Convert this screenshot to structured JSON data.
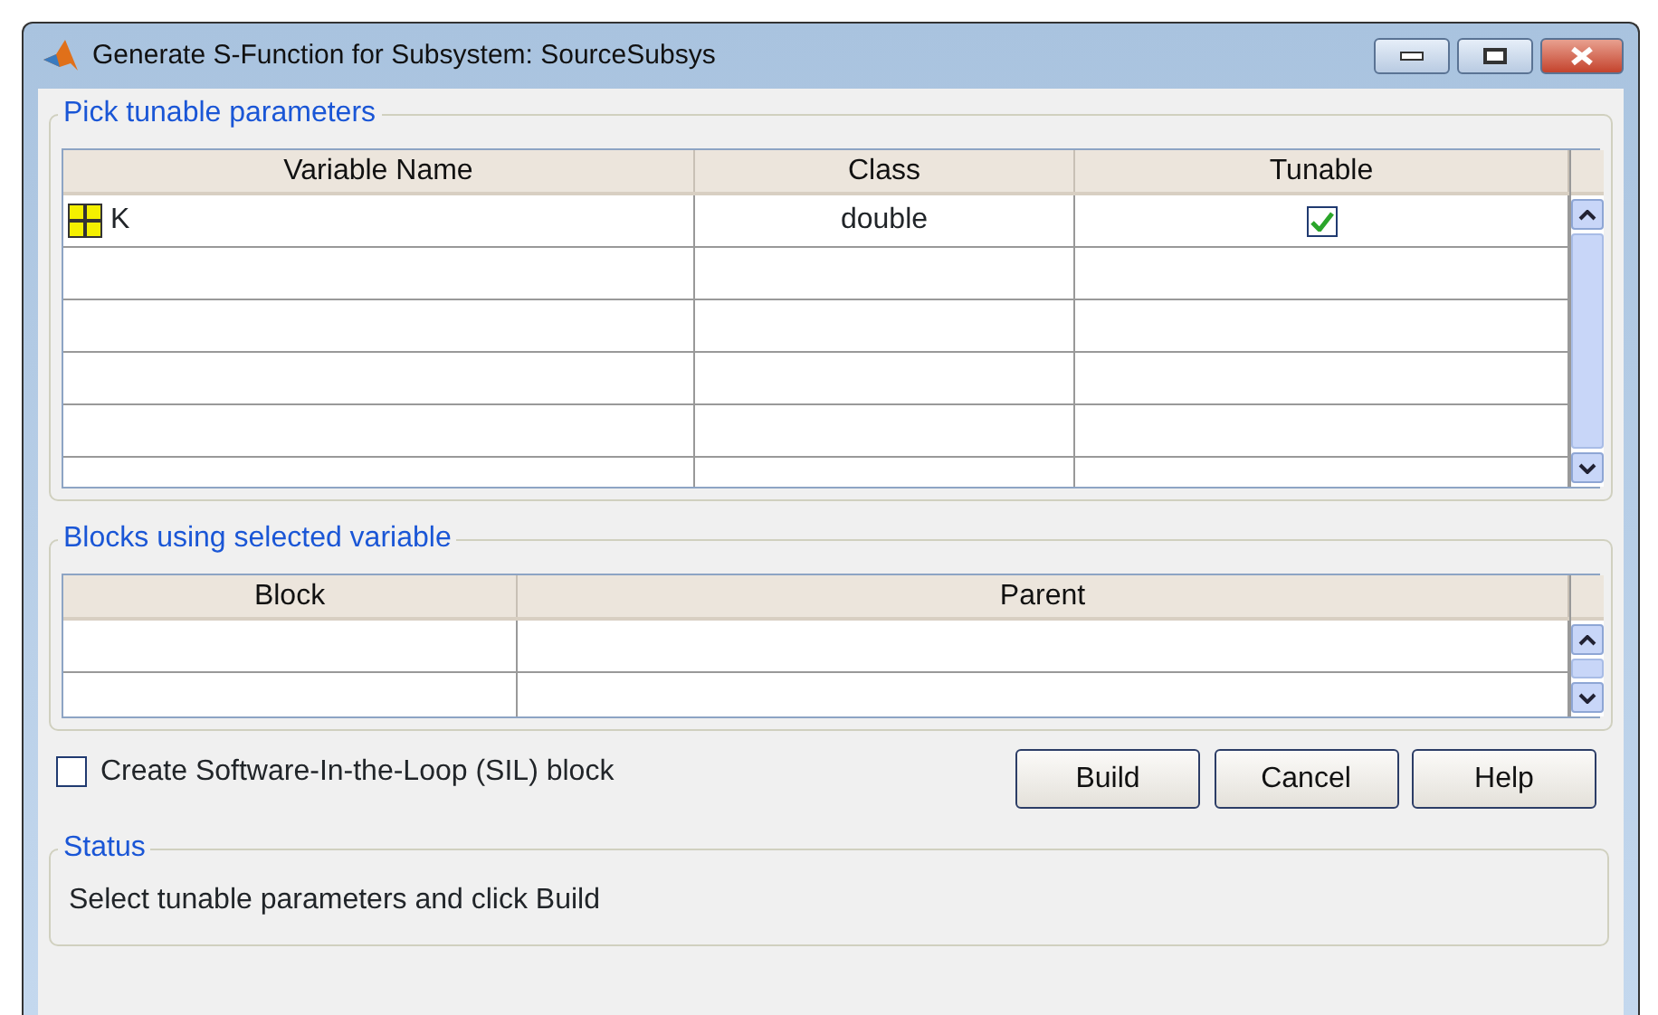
{
  "window": {
    "title": "Generate S-Function for Subsystem: SourceSubsys"
  },
  "tunable_parameters": {
    "title": "Pick tunable parameters",
    "columns": [
      "Variable Name",
      "Class",
      "Tunable"
    ],
    "rows": [
      {
        "name": "K",
        "class": "double",
        "tunable": true
      }
    ]
  },
  "blocks": {
    "title": "Blocks using selected variable",
    "columns": [
      "Block",
      "Parent"
    ]
  },
  "sil_checkbox": {
    "label": "Create Software-In-the-Loop (SIL) block",
    "checked": false
  },
  "buttons": [
    "Build",
    "Cancel",
    "Help"
  ],
  "status": {
    "title": "Status",
    "text": "Select tunable parameters and click Build"
  }
}
